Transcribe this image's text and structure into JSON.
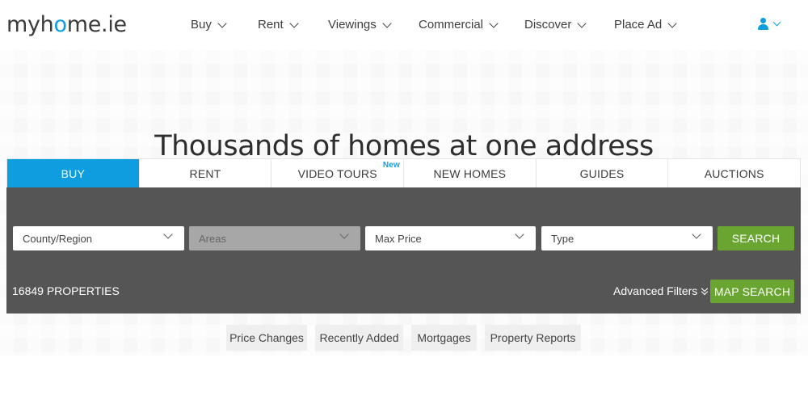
{
  "header": {
    "logo_pre": "myh",
    "logo_o": "o",
    "logo_post": "me.ie",
    "nav": [
      {
        "label": "Buy"
      },
      {
        "label": "Rent"
      },
      {
        "label": "Viewings"
      },
      {
        "label": "Commercial"
      },
      {
        "label": "Discover"
      },
      {
        "label": "Place Ad"
      }
    ],
    "user_icon": "user-icon"
  },
  "hero": {
    "title": "Thousands of homes at one address"
  },
  "tabs": [
    {
      "label": "BUY",
      "active": true
    },
    {
      "label": "RENT"
    },
    {
      "label": "VIDEO TOURS",
      "badge": "New"
    },
    {
      "label": "NEW HOMES"
    },
    {
      "label": "GUIDES"
    },
    {
      "label": "AUCTIONS"
    }
  ],
  "search": {
    "county": "County/Region",
    "areas": "Areas",
    "max_price": "Max Price",
    "type": "Type",
    "search_button": "SEARCH",
    "property_count": "16849 PROPERTIES",
    "advanced_filters": "Advanced Filters",
    "map_search": "MAP SEARCH"
  },
  "quick_links": [
    {
      "label": "Price Changes"
    },
    {
      "label": "Recently Added"
    },
    {
      "label": "Mortgages"
    },
    {
      "label": "Property Reports"
    }
  ],
  "colors": {
    "brand_blue": "#0e9ee0",
    "panel_grey": "#555555",
    "green": "#6aa532"
  }
}
